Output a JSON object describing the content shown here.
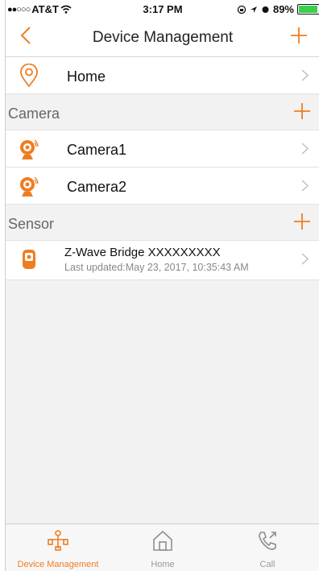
{
  "status_bar": {
    "carrier": "AT&T",
    "time": "3:17 PM",
    "battery": "89%",
    "battery_level": 0.89
  },
  "navbar": {
    "title": "Device Management",
    "back_icon": "chevron-left-icon",
    "add_icon": "plus-icon"
  },
  "home_row": {
    "label": "Home",
    "icon": "location-pin-icon"
  },
  "camera_section": {
    "header": "Camera",
    "items": [
      {
        "label": "Camera1",
        "icon": "camera-icon"
      },
      {
        "label": "Camera2",
        "icon": "camera-icon"
      }
    ]
  },
  "sensor_section": {
    "header": "Sensor",
    "items": [
      {
        "title": "Z-Wave Bridge XXXXXXXXX",
        "subtitle": "Last updated:May 23, 2017, 10:35:43 AM",
        "icon": "bridge-icon"
      }
    ]
  },
  "tabbar": {
    "tabs": [
      {
        "label": "Device Management",
        "icon": "device-tree-icon",
        "active": true
      },
      {
        "label": "Home",
        "icon": "house-icon",
        "active": false
      },
      {
        "label": "Call",
        "icon": "phone-icon",
        "active": false
      }
    ]
  },
  "colors": {
    "accent": "#ee7d22",
    "background": "#f2f2f2",
    "text_secondary": "#888888"
  }
}
